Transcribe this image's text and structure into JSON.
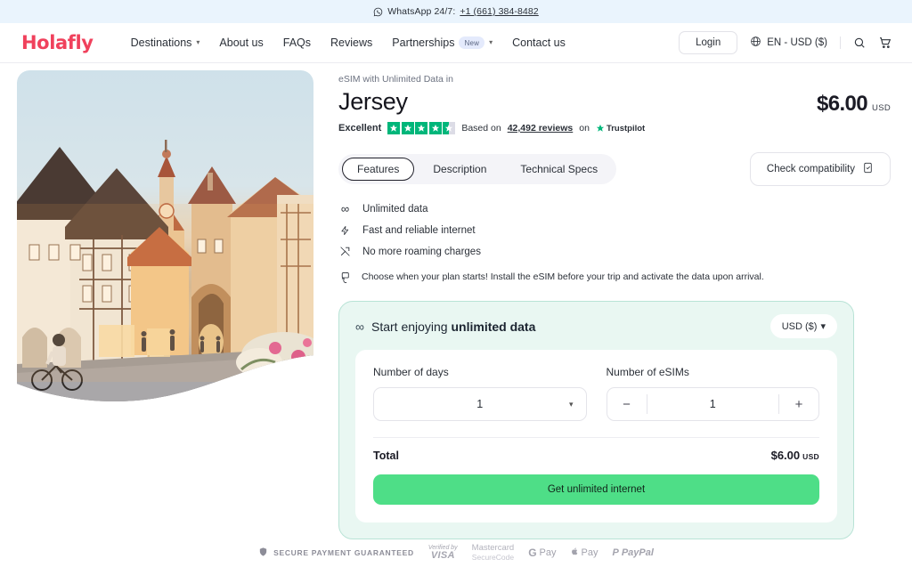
{
  "promo": {
    "icon": "whatsapp-icon",
    "text": "WhatsApp 24/7:",
    "phone": "+1 (661) 384-8482"
  },
  "header": {
    "logo": "Holafly",
    "nav": [
      {
        "label": "Destinations",
        "caret": true
      },
      {
        "label": "About us",
        "caret": false
      },
      {
        "label": "FAQs",
        "caret": false
      },
      {
        "label": "Reviews",
        "caret": false
      },
      {
        "label": "Partnerships",
        "badge": "New",
        "caret": true
      },
      {
        "label": "Contact us",
        "caret": false
      }
    ],
    "login": "Login",
    "locale": "EN - USD ($)",
    "search_icon": "search-icon",
    "cart_icon": "cart-icon",
    "globe_icon": "globe-icon"
  },
  "product": {
    "eyebrow": "eSIM with Unlimited Data in",
    "title": "Jersey",
    "price": "$6.00",
    "price_currency": "USD"
  },
  "trustpilot": {
    "rating_label": "Excellent",
    "stars": 4.5,
    "based_on": "Based on",
    "reviews_count": "42,492 reviews",
    "on": "on",
    "brand": "Trustpilot",
    "star_color": "#00b67a"
  },
  "tabs": {
    "items": [
      {
        "label": "Features",
        "active": true
      },
      {
        "label": "Description",
        "active": false
      },
      {
        "label": "Technical Specs",
        "active": false
      }
    ],
    "compatibility_button": "Check compatibility"
  },
  "features": [
    {
      "icon": "infinity-icon",
      "glyph": "∞",
      "label": "Unlimited data"
    },
    {
      "icon": "lightning-icon",
      "glyph": "⚡",
      "label": "Fast and reliable internet"
    },
    {
      "icon": "no-roaming-icon",
      "glyph": "⤨",
      "label": "No more roaming charges"
    }
  ],
  "notice": {
    "icon": "calendar-hand-icon",
    "text": "Choose when your plan starts! Install the eSIM before your trip and activate the data upon arrival."
  },
  "buy_card": {
    "icon": "infinity-icon",
    "title_prefix": "Start enjoying ",
    "title_strong": "unlimited data",
    "currency_selector": "USD ($)",
    "days": {
      "label": "Number of days",
      "value": "1",
      "icon": "chevron-down-icon"
    },
    "esims": {
      "label": "Number of eSIMs",
      "value": "1",
      "minus": "−",
      "plus": "+"
    },
    "total_label": "Total",
    "total_value": "$6.00",
    "total_currency": "USD",
    "cta": "Get unlimited internet",
    "accent_bg": "#e9f7f2",
    "accent_border": "#b9e3d6",
    "cta_color": "#4ede87"
  },
  "payments": {
    "secure_icon": "shield-icon",
    "secure_text": "SECURE PAYMENT GUARANTEED",
    "visa_top": "Verified by",
    "visa_bottom": "VISA",
    "mastercard_top": "Mastercard",
    "mastercard_bottom": "SecureCode",
    "gpay_g": "G",
    "gpay_label": "Pay",
    "apay_mark": "",
    "apay_label": "Pay",
    "paypal_mark": "P",
    "paypal_label": "PayPal"
  }
}
